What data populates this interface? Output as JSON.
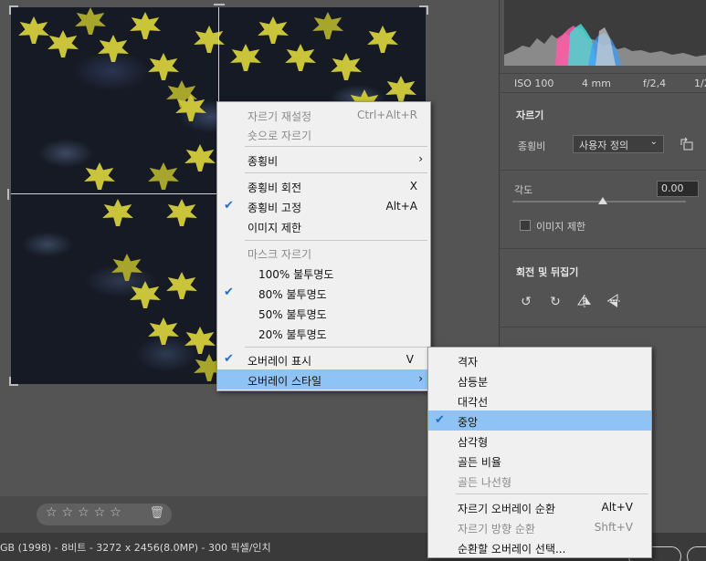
{
  "camera_info": {
    "iso": "ISO 100",
    "focal": "4 mm",
    "aperture": "f/2,4",
    "extra": "1/2"
  },
  "crop_panel": {
    "title": "자르기",
    "ratio_label": "종횡비",
    "ratio_value": "사용자 정의",
    "angle_label": "각도",
    "angle_value": "0.00",
    "constrain_label": "이미지 제한"
  },
  "rotate_panel": {
    "title": "회전 및 뒤집기"
  },
  "rating": {
    "stars": "☆☆☆☆☆",
    "trash_icon": "trash-icon"
  },
  "status": {
    "text": "GB (1998) - 8비트 - 3272 x 2456(8.0MP) - 300 픽셀/인치"
  },
  "context_menu": {
    "reset_crop": "자르기 재설정",
    "crop_to_shot": "숏으로 자르기",
    "aspect_ratio": "종횡비",
    "rotate_ratio": "종횡비 회전",
    "rotate_ratio_shortcut": "X",
    "lock_ratio": "종횡비 고정",
    "lock_ratio_shortcut": "Alt+A",
    "constrain_image": "이미지 제한",
    "mask_header": "마스크 자르기",
    "opacity_100": "100% 불투명도",
    "opacity_80": "80% 불투명도",
    "opacity_50": "50% 불투명도",
    "opacity_20": "20% 불투명도",
    "show_overlay": "오버레이 표시",
    "show_overlay_shortcut": "V",
    "overlay_style": "오버레이 스타일",
    "reset_shortcut": "Ctrl+Alt+R"
  },
  "overlay_submenu": {
    "grid": "격자",
    "thirds": "삼등분",
    "diagonal": "대각선",
    "center": "중앙",
    "triangle": "삼각형",
    "golden_ratio": "골든 비율",
    "golden_spiral": "골든 나선형",
    "cycle_overlay": "자르기 오버레이 순환",
    "cycle_overlay_shortcut": "Alt+V",
    "cycle_orientation": "자르기 방향 순환",
    "cycle_orientation_shortcut": "Shft+V",
    "choose_overlay": "순환할 오버레이 선택..."
  }
}
